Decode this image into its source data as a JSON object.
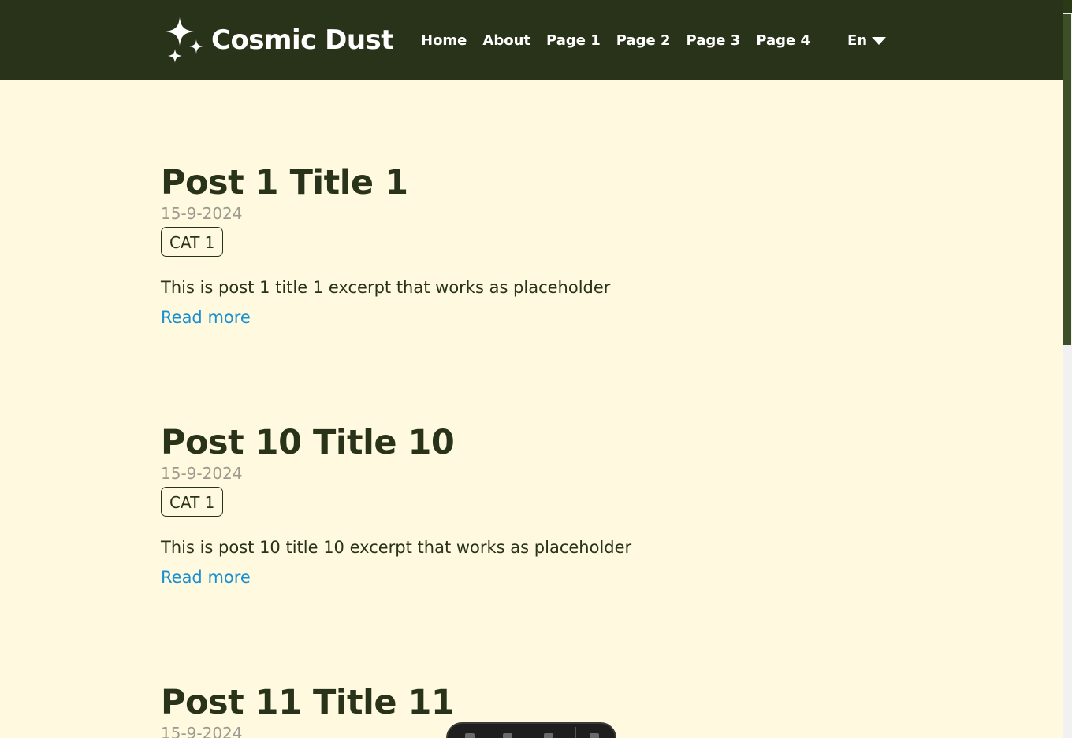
{
  "header": {
    "logo_text": "Cosmic Dust",
    "nav": [
      "Home",
      "About",
      "Page 1",
      "Page 2",
      "Page 3",
      "Page 4"
    ],
    "language": "En"
  },
  "posts": [
    {
      "title": "Post 1 Title 1",
      "date": "15-9-2024",
      "category": "CAT 1",
      "excerpt": "This is post 1 title 1 excerpt that works as placeholder",
      "read_more": "Read more"
    },
    {
      "title": "Post 10 Title 10",
      "date": "15-9-2024",
      "category": "CAT 1",
      "excerpt": "This is post 10 title 10 excerpt that works as placeholder",
      "read_more": "Read more"
    },
    {
      "title": "Post 11 Title 11",
      "date": "15-9-2024"
    }
  ],
  "colors": {
    "header_bg": "#283319",
    "page_bg": "#fffadf",
    "title": "#283319",
    "date": "#9a9a8e",
    "link": "#1a8fd1"
  },
  "icons": {
    "logo": "sparkles-icon",
    "language_toggle": "caret-down-icon"
  }
}
